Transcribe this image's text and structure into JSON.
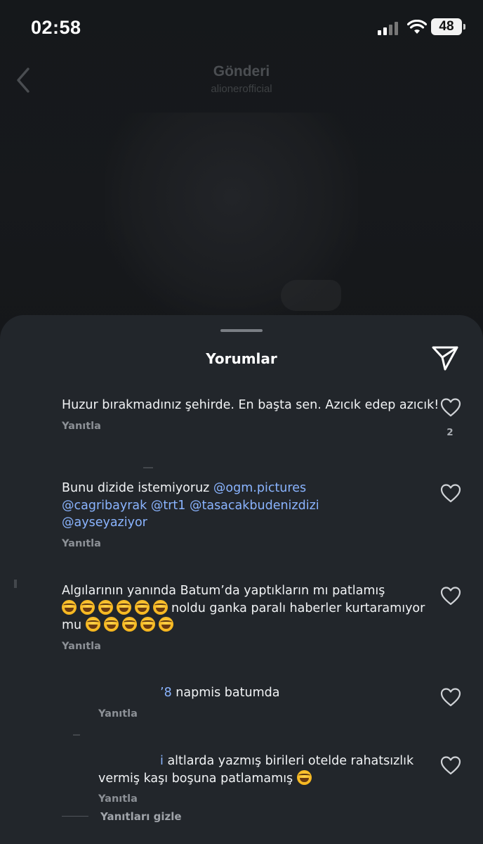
{
  "status_bar": {
    "time": "02:58",
    "battery": "48"
  },
  "header": {
    "title": "Gönderi",
    "subtitle": "alionerofficial"
  },
  "sheet": {
    "title": "Yorumlar"
  },
  "comments": [
    {
      "text_parts": [
        "Huzur bırakmadınız şehirde. En başta sen. Azıcık edep azıcık!"
      ],
      "reply_label": "Yanıtla",
      "likes": "2"
    },
    {
      "text_lead": "Bunu dizide istemiyoruz ",
      "mentions": [
        "@ogm.pictures",
        "@cagribayrak",
        "@trt1",
        "@tasacakbudenizdizi",
        "@ayseyaziyor"
      ],
      "reply_label": "Yanıtla"
    },
    {
      "text_a": "Algılarının yanında Batum’da yaptıkların mı patlamış",
      "emoji_count_a": 6,
      "text_b": "noldu ganka paralı haberler kurtaramıyor mu",
      "emoji_count_b": 5,
      "emoji_name": "face-with-tears-of-joy",
      "reply_label": "Yanıtla"
    },
    {
      "mention_fragment": "’8",
      "text": "napmis batumda",
      "reply_label": "Yanıtla"
    },
    {
      "mention_fragment": "i",
      "text": "altlarda yazmış birileri otelde rahatsızlık vermiş kaşı boşuna patlamamış",
      "emoji_name": "face-with-tears-of-joy",
      "reply_label": "Yanıtla"
    }
  ],
  "hide_replies_label": "Yanıtları gizle",
  "colors": {
    "sheet_bg": "#22262b",
    "mention": "#8ab4ff",
    "muted_text": "#8c9096"
  }
}
